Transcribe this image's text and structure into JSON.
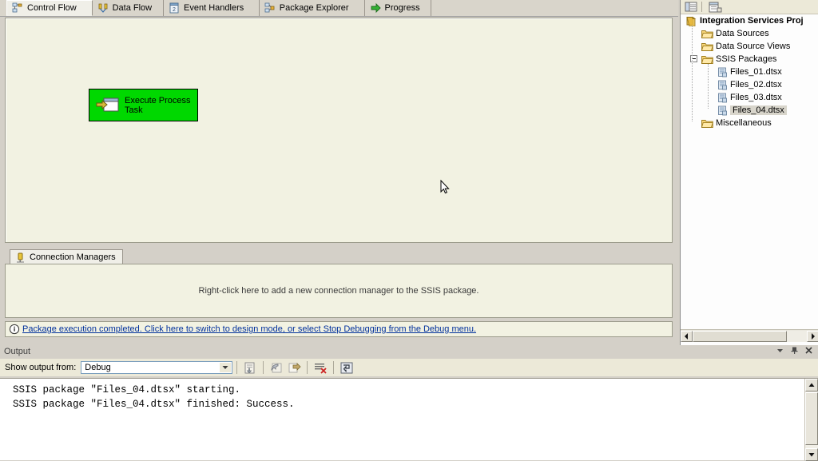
{
  "designer": {
    "tabs": [
      {
        "label": "Control Flow",
        "icon": "control-flow-icon",
        "active": true
      },
      {
        "label": "Data Flow",
        "icon": "data-flow-icon",
        "active": false
      },
      {
        "label": "Event Handlers",
        "icon": "event-handlers-icon",
        "active": false
      },
      {
        "label": "Package Explorer",
        "icon": "package-explorer-icon",
        "active": false
      },
      {
        "label": "Progress",
        "icon": "progress-arrow-icon",
        "active": false
      }
    ],
    "task": {
      "label": "Execute Process Task",
      "icon": "execute-process-task-icon",
      "fill_color": "#00d800",
      "border_color": "#000000"
    },
    "connection_managers": {
      "tab_label": "Connection Managers",
      "tab_icon": "connection-manager-icon",
      "hint": "Right-click here to add a new connection manager to the SSIS package."
    },
    "status": {
      "icon": "info-icon",
      "message": "Package execution completed. Click here to switch to design mode, or select Stop Debugging from the Debug menu.",
      "link_color": "#00309c"
    },
    "canvas_color": "#f2f2e2"
  },
  "solution_explorer": {
    "toolbar": [
      {
        "name": "properties-window-button",
        "icon": "properties-icon"
      },
      {
        "name": "show-all-files-button",
        "icon": "show-all-files-icon"
      }
    ],
    "tree": [
      {
        "label": "Integration Services Proj",
        "icon": "project-icon",
        "indent": 0,
        "bold": true,
        "selected": false,
        "expander": ""
      },
      {
        "label": "Data Sources",
        "icon": "folder-icon",
        "indent": 1,
        "bold": false,
        "selected": false,
        "expander": ""
      },
      {
        "label": "Data Source Views",
        "icon": "folder-icon",
        "indent": 1,
        "bold": false,
        "selected": false,
        "expander": ""
      },
      {
        "label": "SSIS Packages",
        "icon": "folder-icon",
        "indent": 1,
        "bold": false,
        "selected": false,
        "expander": "collapse"
      },
      {
        "label": "Files_01.dtsx",
        "icon": "dtsx-package-icon",
        "indent": 2,
        "bold": false,
        "selected": false,
        "expander": ""
      },
      {
        "label": "Files_02.dtsx",
        "icon": "dtsx-package-icon",
        "indent": 2,
        "bold": false,
        "selected": false,
        "expander": ""
      },
      {
        "label": "Files_03.dtsx",
        "icon": "dtsx-package-icon",
        "indent": 2,
        "bold": false,
        "selected": false,
        "expander": ""
      },
      {
        "label": "Files_04.dtsx",
        "icon": "dtsx-package-icon",
        "indent": 2,
        "bold": false,
        "selected": true,
        "expander": ""
      },
      {
        "label": "Miscellaneous",
        "icon": "folder-icon",
        "indent": 1,
        "bold": false,
        "selected": false,
        "expander": ""
      }
    ]
  },
  "output_panel": {
    "title": "Output",
    "window_controls": [
      {
        "name": "window-dropdown-icon"
      },
      {
        "name": "pin-icon"
      },
      {
        "name": "close-icon"
      }
    ],
    "filter_label": "Show output from:",
    "filter_value": "Debug",
    "toolbar_buttons": [
      {
        "name": "find-message-button",
        "icon": "find-message-icon"
      },
      {
        "name": "go-to-previous-button",
        "icon": "arrow-left-icon"
      },
      {
        "name": "go-to-next-button",
        "icon": "arrow-right-icon"
      },
      {
        "name": "clear-all-button",
        "icon": "clear-all-icon"
      },
      {
        "name": "toggle-word-wrap-button",
        "icon": "word-wrap-icon"
      }
    ],
    "lines": [
      "SSIS package \"Files_04.dtsx\" starting.",
      "SSIS package \"Files_04.dtsx\" finished: Success."
    ]
  }
}
